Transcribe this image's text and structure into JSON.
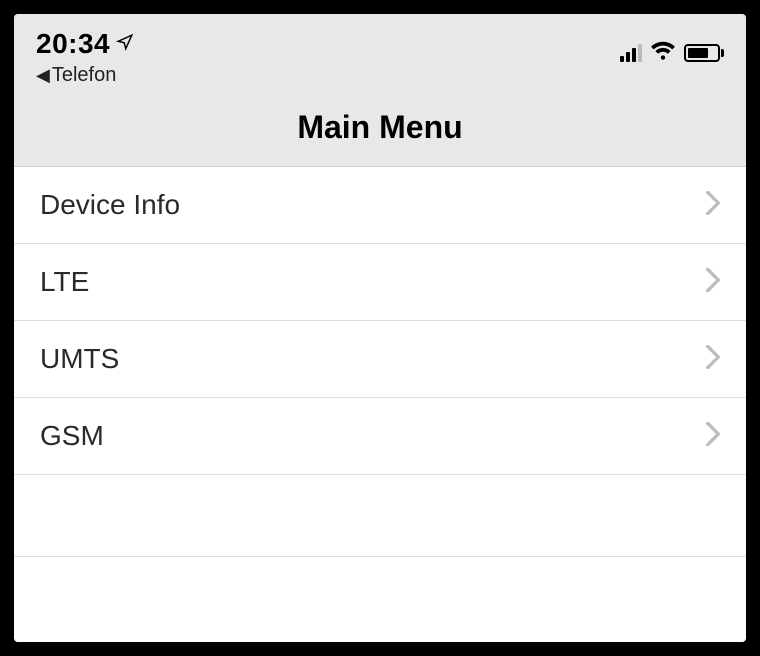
{
  "statusBar": {
    "time": "20:34",
    "backLabel": "Telefon"
  },
  "header": {
    "title": "Main Menu"
  },
  "menu": {
    "items": [
      {
        "label": "Device Info"
      },
      {
        "label": "LTE"
      },
      {
        "label": "UMTS"
      },
      {
        "label": "GSM"
      }
    ]
  }
}
